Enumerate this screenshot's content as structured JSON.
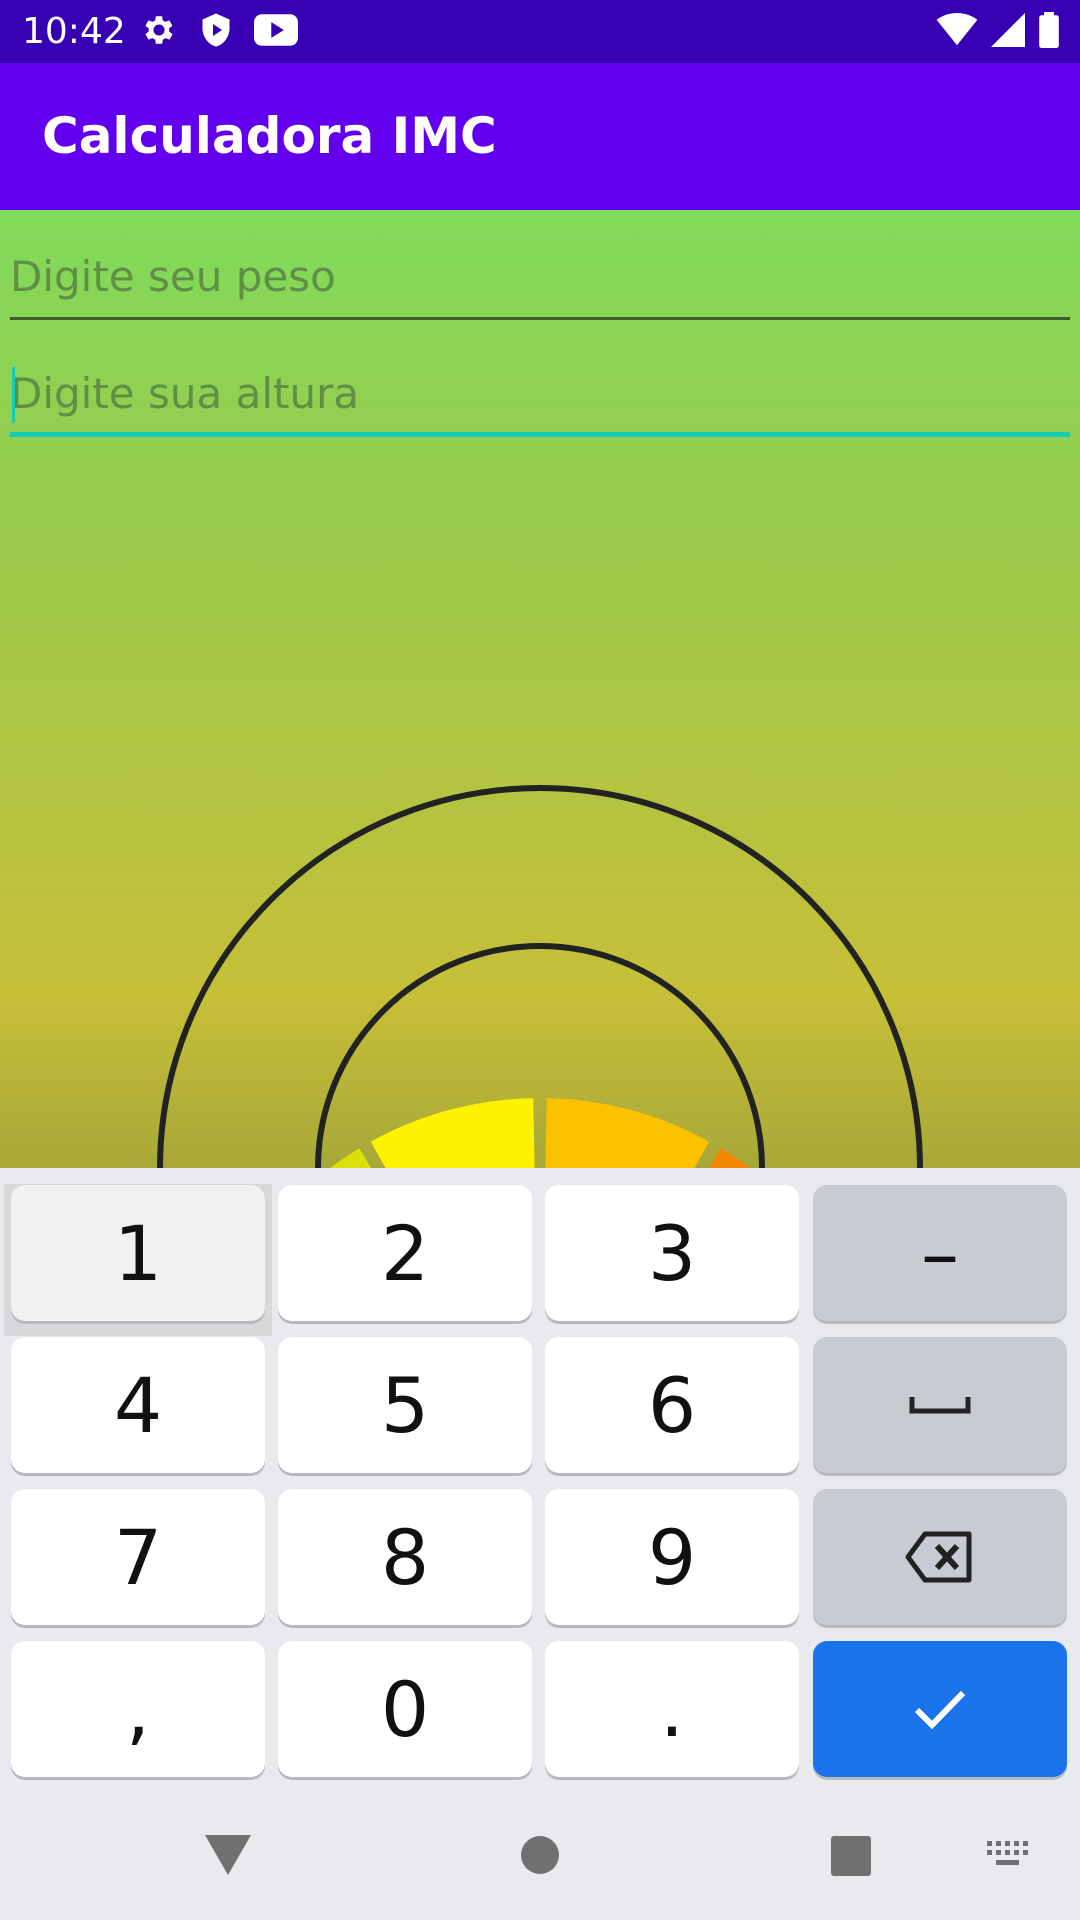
{
  "status_bar": {
    "time": "10:42",
    "icons_left": [
      "gear-icon",
      "shield-icon",
      "youtube-icon"
    ],
    "icons_right": [
      "wifi-icon",
      "signal-icon",
      "battery-icon"
    ]
  },
  "app_bar": {
    "title": "Calculadora IMC",
    "color": "#6200ee"
  },
  "form": {
    "weight": {
      "placeholder": "Digite seu peso",
      "value": ""
    },
    "height": {
      "placeholder": "Digite sua altura",
      "value": "",
      "focused": true
    }
  },
  "gauge": {
    "segment_colors": [
      "#6fd21c",
      "#dbe00a",
      "#fff200",
      "#fcc200",
      "#f48500",
      "#ee5a00"
    ]
  },
  "keyboard": {
    "rows": [
      [
        {
          "label": "1"
        },
        {
          "label": "2"
        },
        {
          "label": "3"
        },
        {
          "label": "–"
        }
      ],
      [
        {
          "label": "4"
        },
        {
          "label": "5"
        },
        {
          "label": "6"
        },
        {
          "label": "space-icon"
        }
      ],
      [
        {
          "label": "7"
        },
        {
          "label": "8"
        },
        {
          "label": "9"
        },
        {
          "label": "backspace-icon"
        }
      ],
      [
        {
          "label": ","
        },
        {
          "label": "0"
        },
        {
          "label": "."
        },
        {
          "label": "check-icon"
        }
      ]
    ],
    "enter_color": "#1a73e8"
  },
  "nav_bar": {
    "icons": [
      "back-icon",
      "home-icon",
      "recents-icon",
      "keyboard-icon"
    ]
  }
}
